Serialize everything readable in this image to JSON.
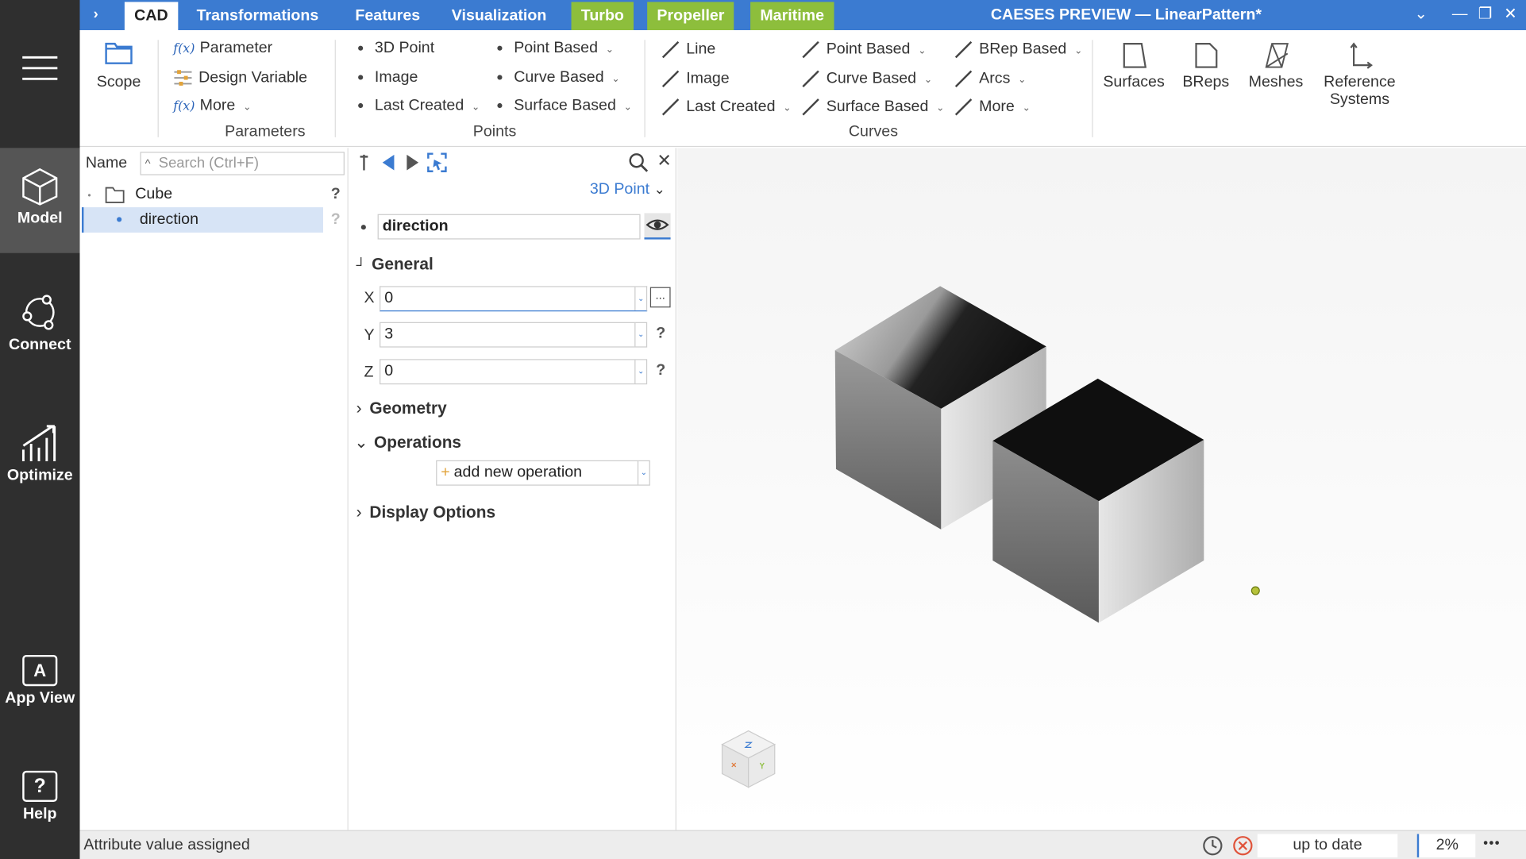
{
  "window": {
    "title": "CAESES PREVIEW — LinearPattern*",
    "expand_glyph": "›",
    "dropdown_glyph": "⌄",
    "minimize_glyph": "—",
    "restore_glyph": "❐",
    "close_glyph": "✕"
  },
  "tabs": [
    {
      "label": "CAD"
    },
    {
      "label": "Transformations"
    },
    {
      "label": "Features"
    },
    {
      "label": "Visualization"
    },
    {
      "label": "Turbo"
    },
    {
      "label": "Propeller"
    },
    {
      "label": "Maritime"
    }
  ],
  "nav": {
    "model": "Model",
    "connect": "Connect",
    "optimize": "Optimize",
    "app_view": "App View",
    "help": "Help",
    "app_view_glyph": "A",
    "help_glyph": "?"
  },
  "ribbon": {
    "scope": "Scope",
    "parameter": "Parameter",
    "design_variable": "Design Variable",
    "more_params": "More",
    "fx": "f(x)",
    "group_parameters": "Parameters",
    "points_col1": [
      "3D Point",
      "Image",
      "Last Created"
    ],
    "points_col2": [
      "Point Based",
      "Curve Based",
      "Surface Based"
    ],
    "group_points": "Points",
    "curves_col1": [
      "Line",
      "Image",
      "Last Created"
    ],
    "curves_col2": [
      "Point Based",
      "Curve Based",
      "Surface Based"
    ],
    "curves_col3": [
      "BRep Based",
      "Arcs",
      "More"
    ],
    "group_curves": "Curves",
    "surfaces": "Surfaces",
    "breps": "BReps",
    "meshes": "Meshes",
    "reference_systems_1": "Reference",
    "reference_systems_2": "Systems",
    "dropdown_glyph": "⌄"
  },
  "tree": {
    "header": "Name",
    "search_placeholder": "Search (Ctrl+F)",
    "search_glyph": "^",
    "items": [
      {
        "label": "Cube",
        "help": "?"
      },
      {
        "label": "direction",
        "help": "?"
      }
    ]
  },
  "props": {
    "type": "3D Point",
    "type_glyph": "⌄",
    "name": "direction",
    "general": "General",
    "x_label": "X",
    "x_value": "0",
    "y_label": "Y",
    "y_value": "3",
    "z_label": "Z",
    "z_value": "0",
    "help": "?",
    "more": "...",
    "geometry": "Geometry",
    "operations": "Operations",
    "add_operation": "add new operation",
    "add_glyph": "+",
    "display_options": "Display Options",
    "close_glyph": "✕",
    "expand_glyph": "›",
    "collapse_glyph": "⌄",
    "general_glyph": "┘",
    "bullet": "•",
    "select_glyph": "⌄"
  },
  "status": {
    "message": "Attribute value assigned",
    "state": "up to date",
    "progress": "2%",
    "more": "•••"
  },
  "colors": {
    "accent": "#3b7bd1",
    "green_tab": "#8dbe3c",
    "nav_bg": "#2f2f2f"
  }
}
